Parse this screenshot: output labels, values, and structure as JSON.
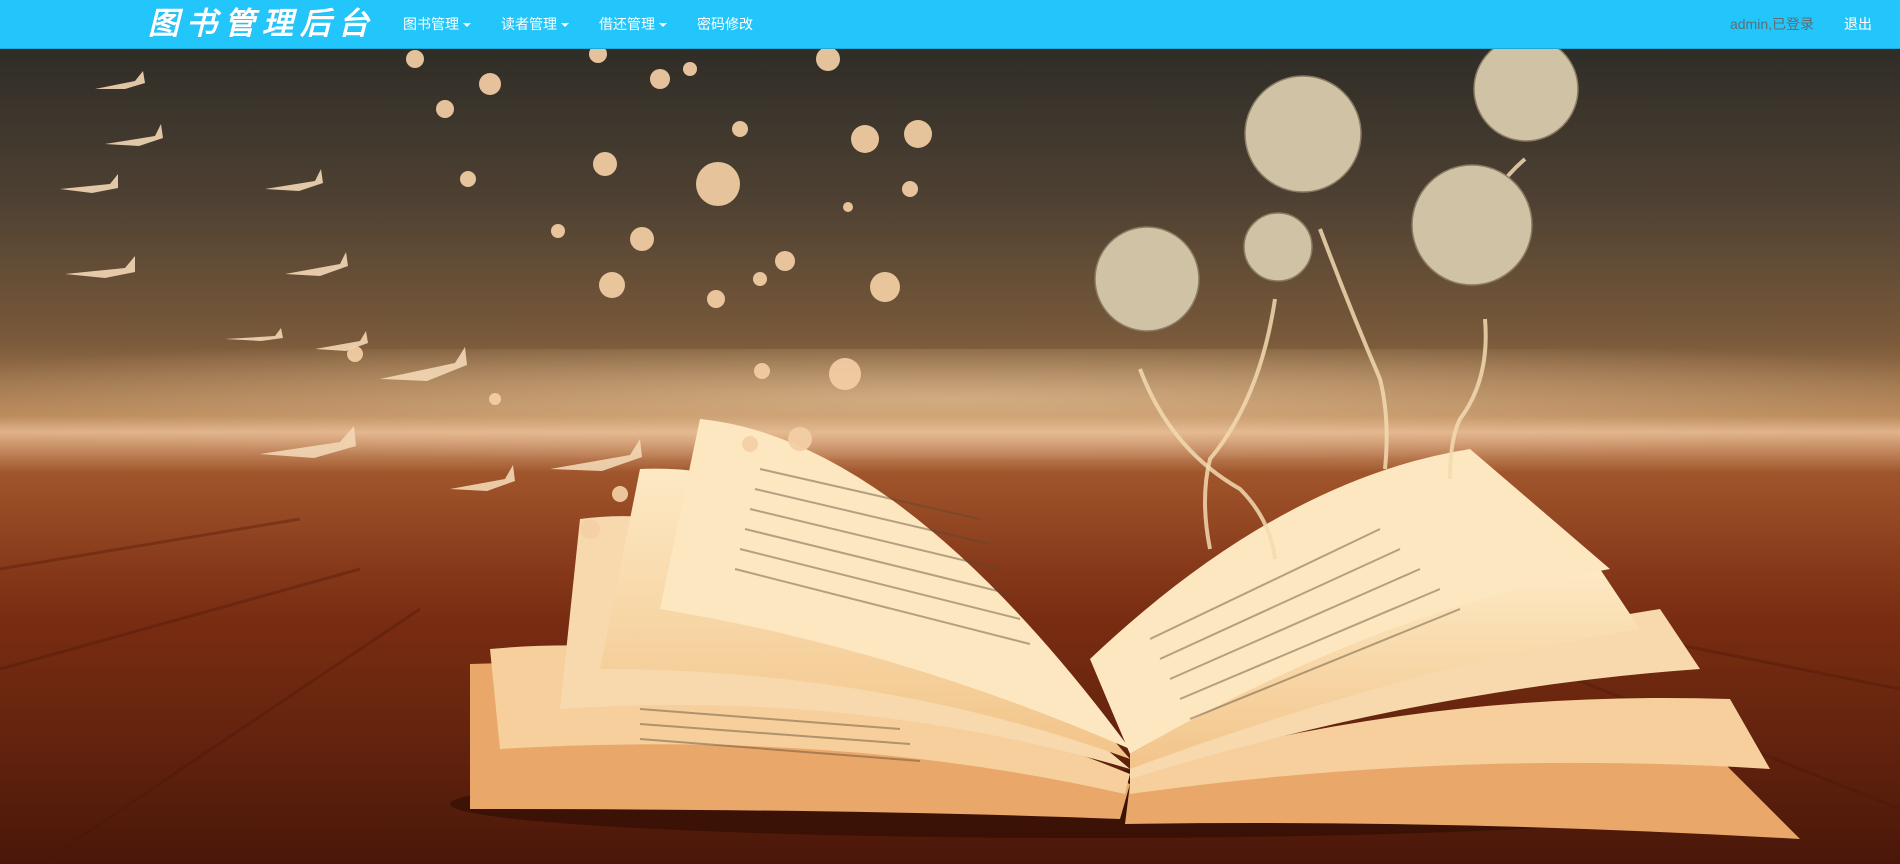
{
  "navbar": {
    "brand": "图书管理后台",
    "menu": [
      {
        "label": "图书管理",
        "dropdown": true
      },
      {
        "label": "读者管理",
        "dropdown": true
      },
      {
        "label": "借还管理",
        "dropdown": true
      },
      {
        "label": "密码修改",
        "dropdown": false
      }
    ],
    "user_status": "admin,已登录",
    "logout_label": "退出"
  },
  "colors": {
    "navbar_bg": "#23c6fb",
    "nav_text": "#ffffff",
    "user_status_text": "#5f6d73"
  },
  "background": {
    "description_icon": "open-book-butterflies-image"
  }
}
